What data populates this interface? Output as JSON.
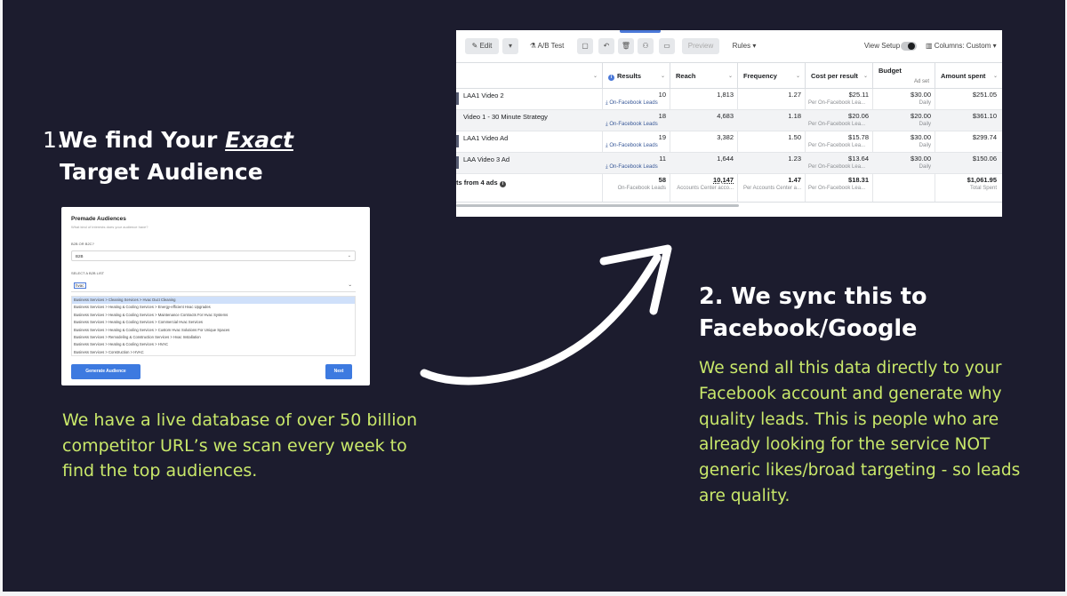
{
  "left": {
    "num": "1.",
    "heading_pre": "We find Your ",
    "heading_em": "Exact",
    "heading_line2": "Target Audience",
    "body": "We have a live database of over 50 billion competitor URL’s we scan every week to find the top audiences."
  },
  "right": {
    "heading_line1": "2. We sync this to",
    "heading_line2": "Facebook/Google",
    "body": "We send all this data directly to your Facebook account and generate why quality leads. This is people who are already looking for the service NOT generic likes/broad targeting - so leads are quality."
  },
  "audience": {
    "title": "Premade Audiences",
    "subtitle": "What kind of interests does your audience have?",
    "b2b_label": "B2B OR B2C?",
    "b2b_value": "B2B",
    "list_label": "SELECT A B2B LIST",
    "search_value": "hvac",
    "options": [
      "Business Services > Cleaning Services > Hvac Duct Cleaning",
      "Business Services > Heating & Cooling Services > Energy-efficient Hvac Upgrades",
      "Business Services > Heating & Cooling Services > Maintenance Contracts For Hvac Systems",
      "Business Services > Heating & Cooling Services > Commercial Hvac Services",
      "Business Services > Heating & Cooling Services > Custom Hvac Solutions For Unique Spaces",
      "Business Services > Remodeling & Construction Services > Hvac Installation",
      "Business Services > Heating & Cooling Services > HVAC",
      "Business Services > Construction > HVAC"
    ],
    "generate_label": "Generate Audience",
    "next_label": "Next"
  },
  "ads": {
    "toolbar": {
      "edit": "Edit",
      "ab_test": "A/B Test",
      "preview": "Preview",
      "rules": "Rules",
      "view_setup": "View Setup",
      "columns": "Columns: Custom"
    },
    "headers": {
      "results": "Results",
      "reach": "Reach",
      "frequency": "Frequency",
      "cost": "Cost per result",
      "budget": "Budget",
      "budget_sub": "Ad set",
      "amount": "Amount spent"
    },
    "rows": [
      {
        "name": "LAA1 Video 2",
        "results": "10",
        "results_sub": "On-Facebook Leads",
        "reach": "1,813",
        "frequency": "1.27",
        "cost": "$25.11",
        "cost_sub": "Per On-Facebook Lea...",
        "budget": "$30.00",
        "budget_sub": "Daily",
        "amount": "$251.05"
      },
      {
        "name": "Video 1 - 30 Minute Strategy",
        "results": "18",
        "results_sub": "On-Facebook Leads",
        "reach": "4,683",
        "frequency": "1.18",
        "cost": "$20.06",
        "cost_sub": "Per On-Facebook Lea...",
        "budget": "$20.00",
        "budget_sub": "Daily",
        "amount": "$361.10"
      },
      {
        "name": "LAA1 Video Ad",
        "results": "19",
        "results_sub": "On-Facebook Leads",
        "reach": "3,382",
        "frequency": "1.50",
        "cost": "$15.78",
        "cost_sub": "Per On-Facebook Lea...",
        "budget": "$30.00",
        "budget_sub": "Daily",
        "amount": "$299.74"
      },
      {
        "name": "LAA Video 3 Ad",
        "results": "11",
        "results_sub": "On-Facebook Leads",
        "reach": "1,644",
        "frequency": "1.23",
        "cost": "$13.64",
        "cost_sub": "Per On-Facebook Lea...",
        "budget": "$30.00",
        "budget_sub": "Daily",
        "amount": "$150.06"
      }
    ],
    "total": {
      "name": "ts from 4 ads",
      "results": "58",
      "results_sub": "On-Facebook Leads",
      "reach": "10,147",
      "reach_sub": "Accounts Center acco...",
      "frequency": "1.47",
      "frequency_sub": "Per Accounts Center a...",
      "cost": "$18.31",
      "cost_sub": "Per On-Facebook Lea...",
      "amount": "$1,061.95",
      "amount_sub": "Total Spent"
    }
  },
  "colors": {
    "background": "#1c1c2e",
    "accent_green": "#c9e86a",
    "fb_blue": "#4a78d8"
  }
}
